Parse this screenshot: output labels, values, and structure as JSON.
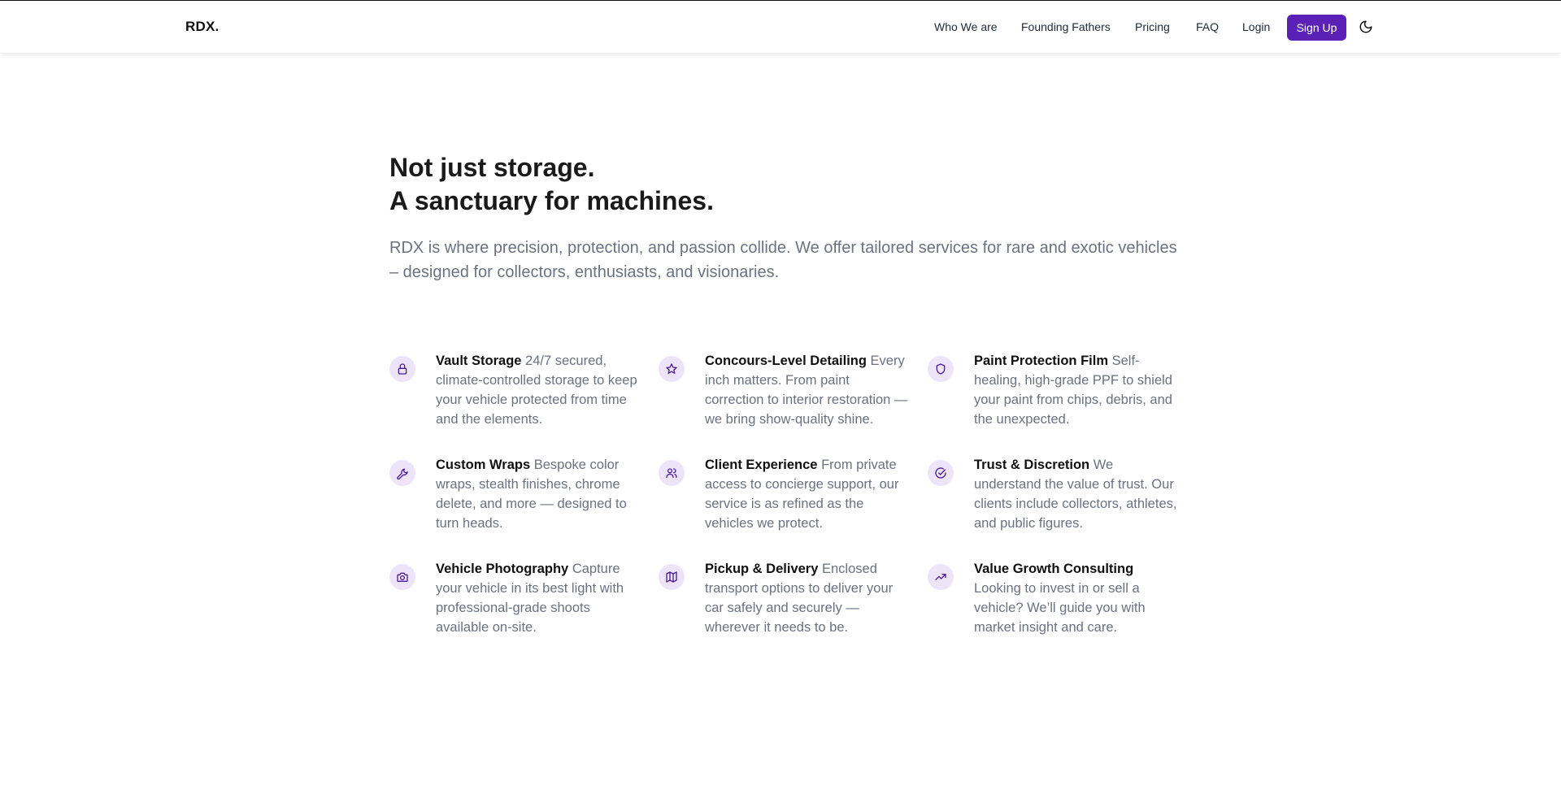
{
  "header": {
    "logo": "RDX.",
    "nav": [
      "Who We are",
      "Founding Fathers",
      "Pricing",
      "FAQ",
      "Login"
    ],
    "signup_label": "Sign Up",
    "theme_toggle_icon": "moon-icon"
  },
  "hero": {
    "title_line1": "Not just storage.",
    "title_line2": "A sanctuary for machines.",
    "subtitle": "RDX is where precision, protection, and passion collide. We offer tailored services for rare and exotic vehicles – designed for collectors, enthusiasts, and visionaries."
  },
  "colors": {
    "accent": "#5b21b6",
    "icon_bg": "#ede4f9",
    "icon_stroke": "#4c1d95"
  },
  "features": [
    {
      "icon": "lock-icon",
      "title": "Vault Storage",
      "desc": "24/7 secured, climate-controlled storage to keep your vehicle protected from time and the elements."
    },
    {
      "icon": "star-icon",
      "title": "Concours-Level Detailing",
      "desc": "Every inch matters. From paint correction to interior restoration — we bring show-quality shine."
    },
    {
      "icon": "shield-icon",
      "title": "Paint Protection Film",
      "desc": "Self-healing, high-grade PPF to shield your paint from chips, debris, and the unexpected."
    },
    {
      "icon": "wrench-icon",
      "title": "Custom Wraps",
      "desc": "Bespoke color wraps, stealth finishes, chrome delete, and more — designed to turn heads."
    },
    {
      "icon": "users-icon",
      "title": "Client Experience",
      "desc": "From private access to concierge support, our service is as refined as the vehicles we protect."
    },
    {
      "icon": "check-circle-icon",
      "title": "Trust & Discretion",
      "desc": "We understand the value of trust. Our clients include collectors, athletes, and public figures."
    },
    {
      "icon": "camera-icon",
      "title": "Vehicle Photography",
      "desc": "Capture your vehicle in its best light with professional-grade shoots available on-site."
    },
    {
      "icon": "map-icon",
      "title": "Pickup & Delivery",
      "desc": "Enclosed transport options to deliver your car safely and securely — wherever it needs to be."
    },
    {
      "icon": "trending-up-icon",
      "title": "Value Growth Consulting",
      "desc": "Looking to invest in or sell a vehicle? We’ll guide you with market insight and care."
    }
  ]
}
